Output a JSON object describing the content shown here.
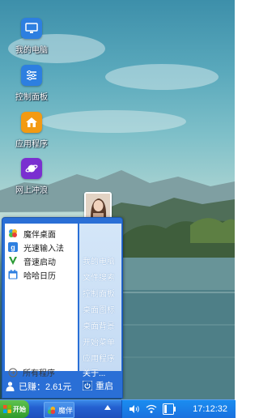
{
  "desktop": {
    "icons": [
      {
        "label": "我的电脑",
        "icon": "monitor-icon"
      },
      {
        "label": "控制面板",
        "icon": "sliders-icon"
      },
      {
        "label": "应用程序",
        "icon": "house-icon"
      },
      {
        "label": "网上冲浪",
        "icon": "planet-icon"
      }
    ]
  },
  "start_menu": {
    "items": [
      {
        "label": "魔伴桌面",
        "icon": "pinwheel-icon"
      },
      {
        "label": "光速输入法",
        "icon": "g-keyboard-icon"
      },
      {
        "label": "音速启动",
        "icon": "v-launch-icon"
      },
      {
        "label": "哈哈日历",
        "icon": "calendar-icon"
      }
    ],
    "all_programs": "所有程序",
    "right_links": [
      "我的电脑",
      "文件搜索",
      "控制面板",
      "桌面图标",
      "桌面背景",
      "开始菜单",
      "应用程序",
      "关于..."
    ],
    "earned": "已赚：2.61元",
    "restart": "重启"
  },
  "taskbar": {
    "start_label": "开始",
    "task_label": "魔伴",
    "clock": "17:12:32"
  },
  "colors": {
    "taskbar": "#2460d0",
    "menu_border": "#2a6fd6",
    "start_green": "#2f9a2c"
  }
}
